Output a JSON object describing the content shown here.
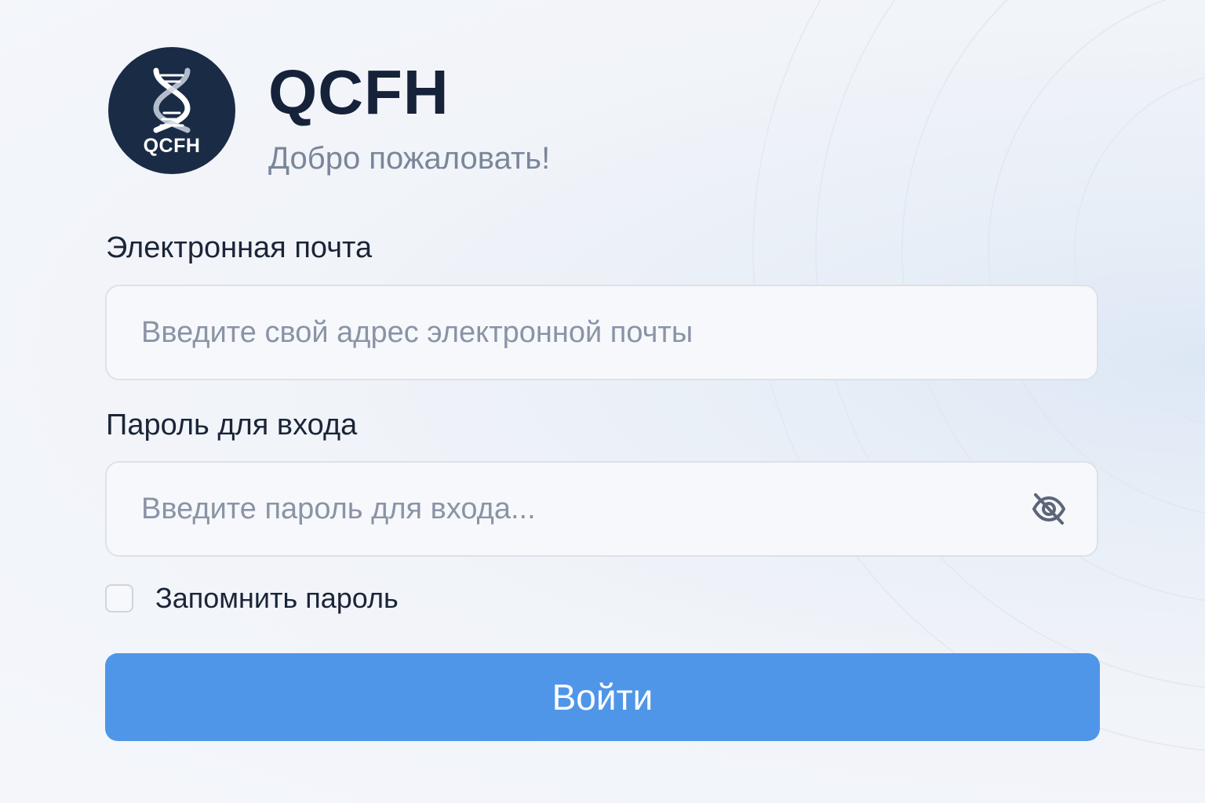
{
  "brand": {
    "logo_text": "QCFH",
    "logo_icon": "dna-icon",
    "title": "QCFH",
    "welcome": "Добро пожаловать!"
  },
  "form": {
    "email": {
      "label": "Электронная почта",
      "placeholder": "Введите свой адрес электронной почты",
      "value": ""
    },
    "password": {
      "label": "Пароль для входа",
      "placeholder": "Введите пароль для входа...",
      "value": "",
      "toggle_icon": "eye-off-icon"
    },
    "remember": {
      "label": "Запомнить пароль",
      "checked": false
    },
    "submit_label": "Войти"
  },
  "colors": {
    "logo_background": "#1a2b45",
    "title_text": "#152239",
    "muted_text": "#7a8699",
    "primary_button": "#5096e8",
    "page_background": "#f4f6fa"
  }
}
